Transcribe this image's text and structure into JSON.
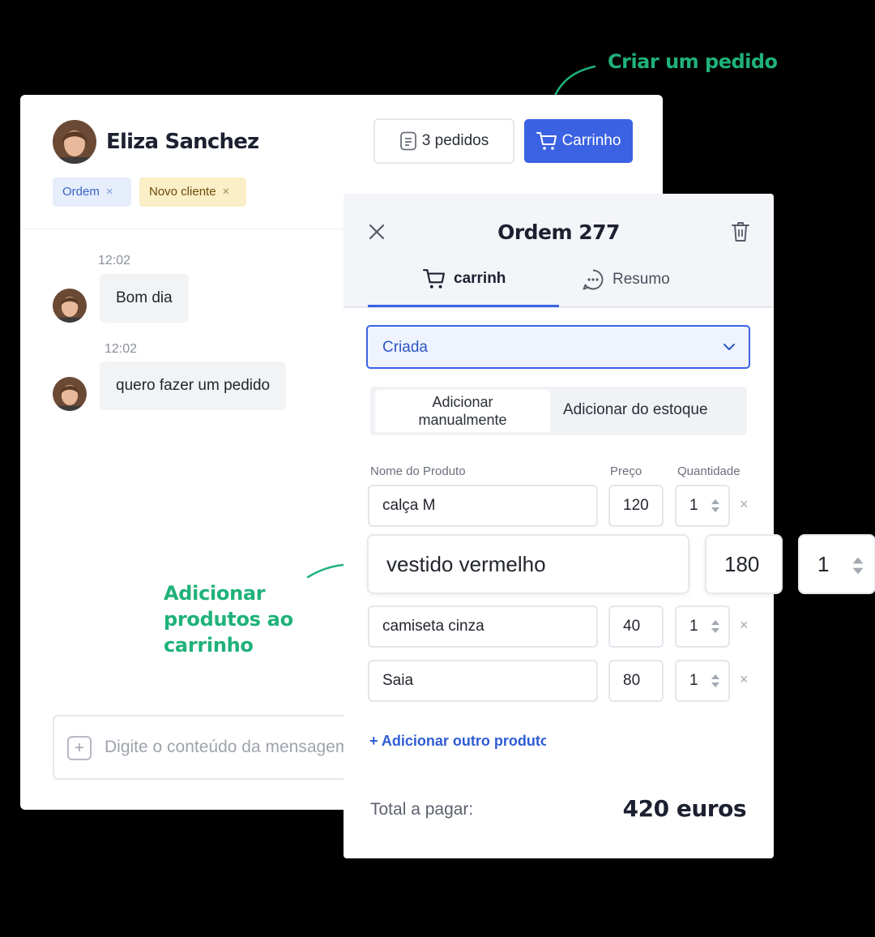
{
  "annotations": {
    "create_order": "Criar um pedido",
    "add_products_line1": "Adicionar",
    "add_products_line2": "produtos ao",
    "add_products_line3": "carrinho"
  },
  "chat": {
    "customer_name": "Eliza Sanchez",
    "tags": [
      {
        "label": "Ordem",
        "remove": "×"
      },
      {
        "label": "Novo cliente",
        "remove": "×"
      }
    ],
    "orders_button": "3 pedidos",
    "cart_button": "Carrinho",
    "messages": [
      {
        "time": "12:02",
        "text": "Bom dia"
      },
      {
        "time": "12:02",
        "text": "quero fazer um pedido"
      }
    ],
    "composer_placeholder": "Digite o conteúdo da mensagem"
  },
  "order": {
    "title": "Ordem 277",
    "tabs": [
      {
        "label": "carrinh",
        "icon": "cart-icon"
      },
      {
        "label": "Resumo",
        "icon": "chat-bubble-icon"
      }
    ],
    "status": "Criada",
    "mode_options": [
      "Adicionar manualmente",
      "Adicionar do estoque"
    ],
    "mode_a_line1": "Adicionar",
    "mode_a_line2": "manualmente",
    "columns": {
      "name": "Nome do Produto",
      "price": "Preço",
      "qty": "Quantidade"
    },
    "items": [
      {
        "name": "calça M",
        "price": "120",
        "qty": "1"
      },
      {
        "name": "vestido vermelho",
        "price": "180",
        "qty": "1"
      },
      {
        "name": "camiseta cinza",
        "price": "40",
        "qty": "1"
      },
      {
        "name": "Saia",
        "price": "80",
        "qty": "1"
      }
    ],
    "remove_glyph": "×",
    "add_more": "+ Adicionar outro produto",
    "total_label": "Total a pagar:",
    "total_value": "420 euros"
  },
  "colors": {
    "accent": "#3b62e2",
    "annotation": "#1fb27a",
    "tag_ordem_bg": "#e6edfb",
    "tag_novo_bg": "#fbefc8"
  }
}
